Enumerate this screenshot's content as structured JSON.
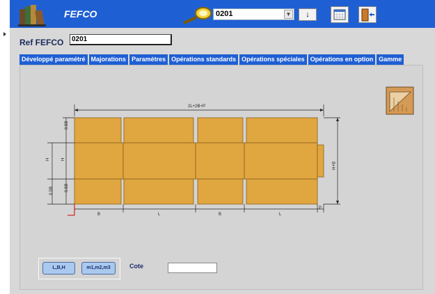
{
  "header": {
    "app_title": "FEFCO",
    "search_value": "0201",
    "go_button_label": "↓"
  },
  "form": {
    "ref_label": "Ref FEFCO",
    "ref_value": "0201"
  },
  "tabs": [
    {
      "label": "Développé paramétré"
    },
    {
      "label": "Majorations"
    },
    {
      "label": "Paramètres"
    },
    {
      "label": "Opérations standards"
    },
    {
      "label": "Opérations spéciales"
    },
    {
      "label": "Opérations en option"
    },
    {
      "label": "Gamme"
    }
  ],
  "diagram": {
    "top_label": "2L+2B+P",
    "right_label": "B+H",
    "left_labels": [
      "0.5B",
      "H",
      "0.5B"
    ],
    "inner_left_labels": [
      "0.5B",
      "H",
      "0.5B"
    ],
    "bottom_labels": [
      "B",
      "L",
      "B",
      "L",
      "P"
    ]
  },
  "buttons": {
    "lbh": "L,B,H",
    "m123": "m1,m2,m3"
  },
  "cote": {
    "label": "Cote",
    "value": ""
  },
  "colors": {
    "header_blue": "#1f5fd4",
    "panel_orange": "#e0a640"
  }
}
